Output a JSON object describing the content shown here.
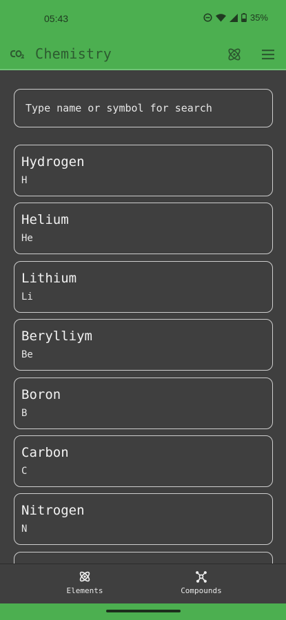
{
  "status_bar": {
    "time": "05:43",
    "battery": "35%",
    "icons": [
      "do-not-disturb-icon",
      "wifi-icon",
      "signal-icon",
      "battery-icon"
    ]
  },
  "app_bar": {
    "logo_icon": "co2-icon",
    "title": "Chemistry",
    "actions": [
      "atom-icon",
      "menu-icon"
    ]
  },
  "search": {
    "placeholder": "Type name or symbol for search"
  },
  "elements": [
    {
      "name": "Hydrogen",
      "symbol": "H"
    },
    {
      "name": "Helium",
      "symbol": "He"
    },
    {
      "name": "Lithium",
      "symbol": "Li"
    },
    {
      "name": "Berylliym",
      "symbol": "Be"
    },
    {
      "name": "Boron",
      "symbol": "B"
    },
    {
      "name": "Carbon",
      "symbol": "C"
    },
    {
      "name": "Nitrogen",
      "symbol": "N"
    },
    {
      "name": "",
      "symbol": ""
    }
  ],
  "bottom_nav": {
    "items": [
      {
        "label": "Elements",
        "icon": "atom-icon"
      },
      {
        "label": "Compounds",
        "icon": "molecule-icon"
      }
    ]
  },
  "colors": {
    "primary": "#4caf50",
    "background": "#3f3f3f",
    "card_border": "#cfcfcf",
    "text": "#f2f2f2"
  }
}
